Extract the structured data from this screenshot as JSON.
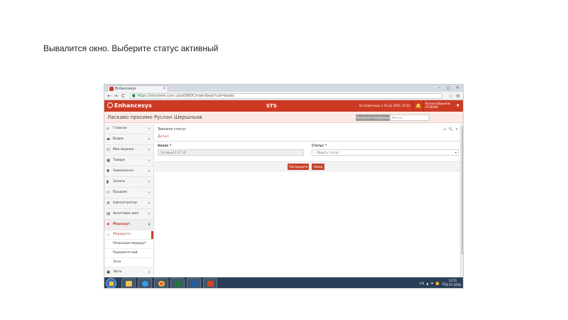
{
  "slide": {
    "title": "Вывалится окно. Выберите статус активный"
  },
  "browser": {
    "tab_title": "Enhancesys",
    "tab_close": "×",
    "window_controls": "– ▢ ×",
    "nav_back": "←",
    "nav_forward": "→",
    "nav_reload": "C",
    "url_secure": "https://",
    "url_rest": "stsystem.com.ua/stSNOC/main/beat?cat=beats",
    "star": "☆",
    "menu": "≡"
  },
  "header": {
    "logo": "Enhancesys",
    "center_label": "STS",
    "last_login": "Осталий вход ⊙ 01 Jul 2016, 10:03",
    "user_line1": "Руслан Шарипов",
    "user_line2": "FU30000",
    "caret": "▼"
  },
  "greeting_bar": {
    "greeting": "Ласкаво просимо Руслан Шершньов",
    "info_button": "Последнее информация",
    "search_placeholder": "Искать"
  },
  "sidebar": {
    "items": [
      {
        "icon": "home-icon",
        "glyph": "⌂",
        "label": "Главная"
      },
      {
        "icon": "car-icon",
        "glyph": "▬",
        "label": "Водии"
      },
      {
        "icon": "network-icon",
        "glyph": "☷",
        "label": "Моя мережа"
      },
      {
        "icon": "grid-icon",
        "glyph": "▦",
        "label": "Товари"
      },
      {
        "icon": "cart-icon",
        "glyph": "▼",
        "label": "Замовлення"
      },
      {
        "icon": "book-icon",
        "glyph": "▮",
        "label": "Запаси"
      },
      {
        "icon": "card-icon",
        "glyph": "▭",
        "label": "Продажі"
      },
      {
        "icon": "gear-icon",
        "glyph": "⚙",
        "label": "Адміністратор"
      },
      {
        "icon": "doc-icon",
        "glyph": "▤",
        "label": "Архетовик дані"
      }
    ],
    "active_item": {
      "icon": "plus-icon",
      "glyph": "✚",
      "label": "Маршрут"
    },
    "sub_items": [
      "Маршрути",
      "Операции маршрут",
      "Приоритетний",
      "Зона"
    ],
    "last_item": {
      "icon": "map-icon",
      "glyph": "▣",
      "label": "Звіти"
    },
    "chevron": "∨"
  },
  "main": {
    "panel_title": "Змінити статус",
    "tools": "⊿",
    "tools_search": "🔍",
    "tools_collapse": "∧",
    "tab_label": "Деталі",
    "name_label": "Назва *",
    "name_value": "Чутивни11.07.16",
    "status_label": "Статус *",
    "status_value": "- Оберіть статус -",
    "select_caret": "▾",
    "save_button": "Підтвердити",
    "back_button": "Назад"
  },
  "taskbar": {
    "tray": "UK  ▲  ⚑ 📶 🔊",
    "time": "12:51",
    "date": "02.07.2016"
  },
  "colors": {
    "brand_red": "#cc3a24",
    "greeting_bg": "#fbe9e5",
    "taskbar": "#2a3e57"
  }
}
